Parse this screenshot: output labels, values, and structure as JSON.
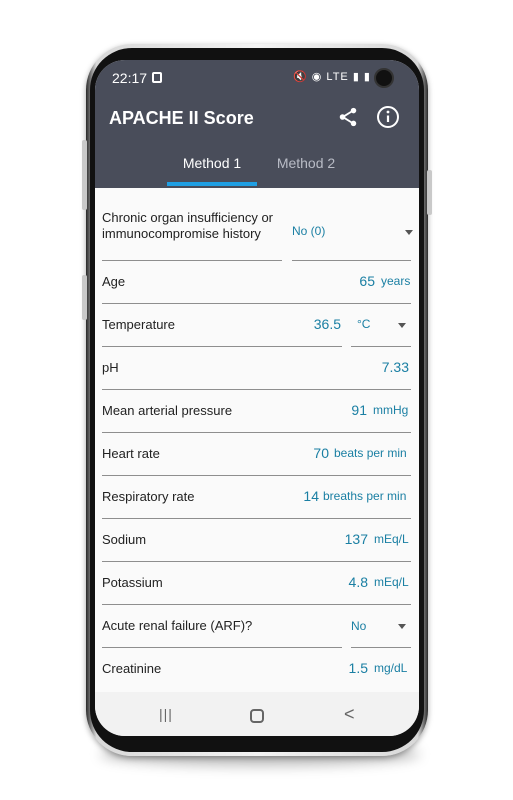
{
  "status_bar": {
    "time": "22:17",
    "icons_text": "🔇 ◉ LTE ▮ ▮"
  },
  "app_bar": {
    "title": "APACHE II Score",
    "share_icon": "share-icon",
    "info_icon": "info-icon",
    "tabs": [
      {
        "label": "Method 1",
        "selected": true
      },
      {
        "label": "Method 2",
        "selected": false
      }
    ],
    "accent_color": "#1f9fe3",
    "bar_color": "#494d5a"
  },
  "form": {
    "chronic": {
      "label": "Chronic organ insufficiency or immunocompromise history",
      "value": "No (0)"
    },
    "age": {
      "label": "Age",
      "value": "65",
      "unit": "years"
    },
    "temperature": {
      "label": "Temperature",
      "value": "36.5",
      "unit": "°C"
    },
    "ph": {
      "label": "pH",
      "value": "7.33"
    },
    "map": {
      "label": "Mean arterial pressure",
      "value": "91",
      "unit": "mmHg"
    },
    "heart_rate": {
      "label": "Heart rate",
      "value": "70",
      "unit": "beats per min"
    },
    "resp_rate": {
      "label": "Respiratory rate",
      "value": "14",
      "unit": "breaths per min"
    },
    "sodium": {
      "label": "Sodium",
      "value": "137",
      "unit": "mEq/L"
    },
    "potassium": {
      "label": "Potassium",
      "value": "4.8",
      "unit": "mEq/L"
    },
    "arf": {
      "label": "Acute renal failure (ARF)?",
      "value": "No"
    },
    "creatinine": {
      "label": "Creatinine",
      "value": "1.5",
      "unit": "mg/dL"
    }
  },
  "nav_bar": {
    "recent": "|||",
    "back": "<"
  }
}
